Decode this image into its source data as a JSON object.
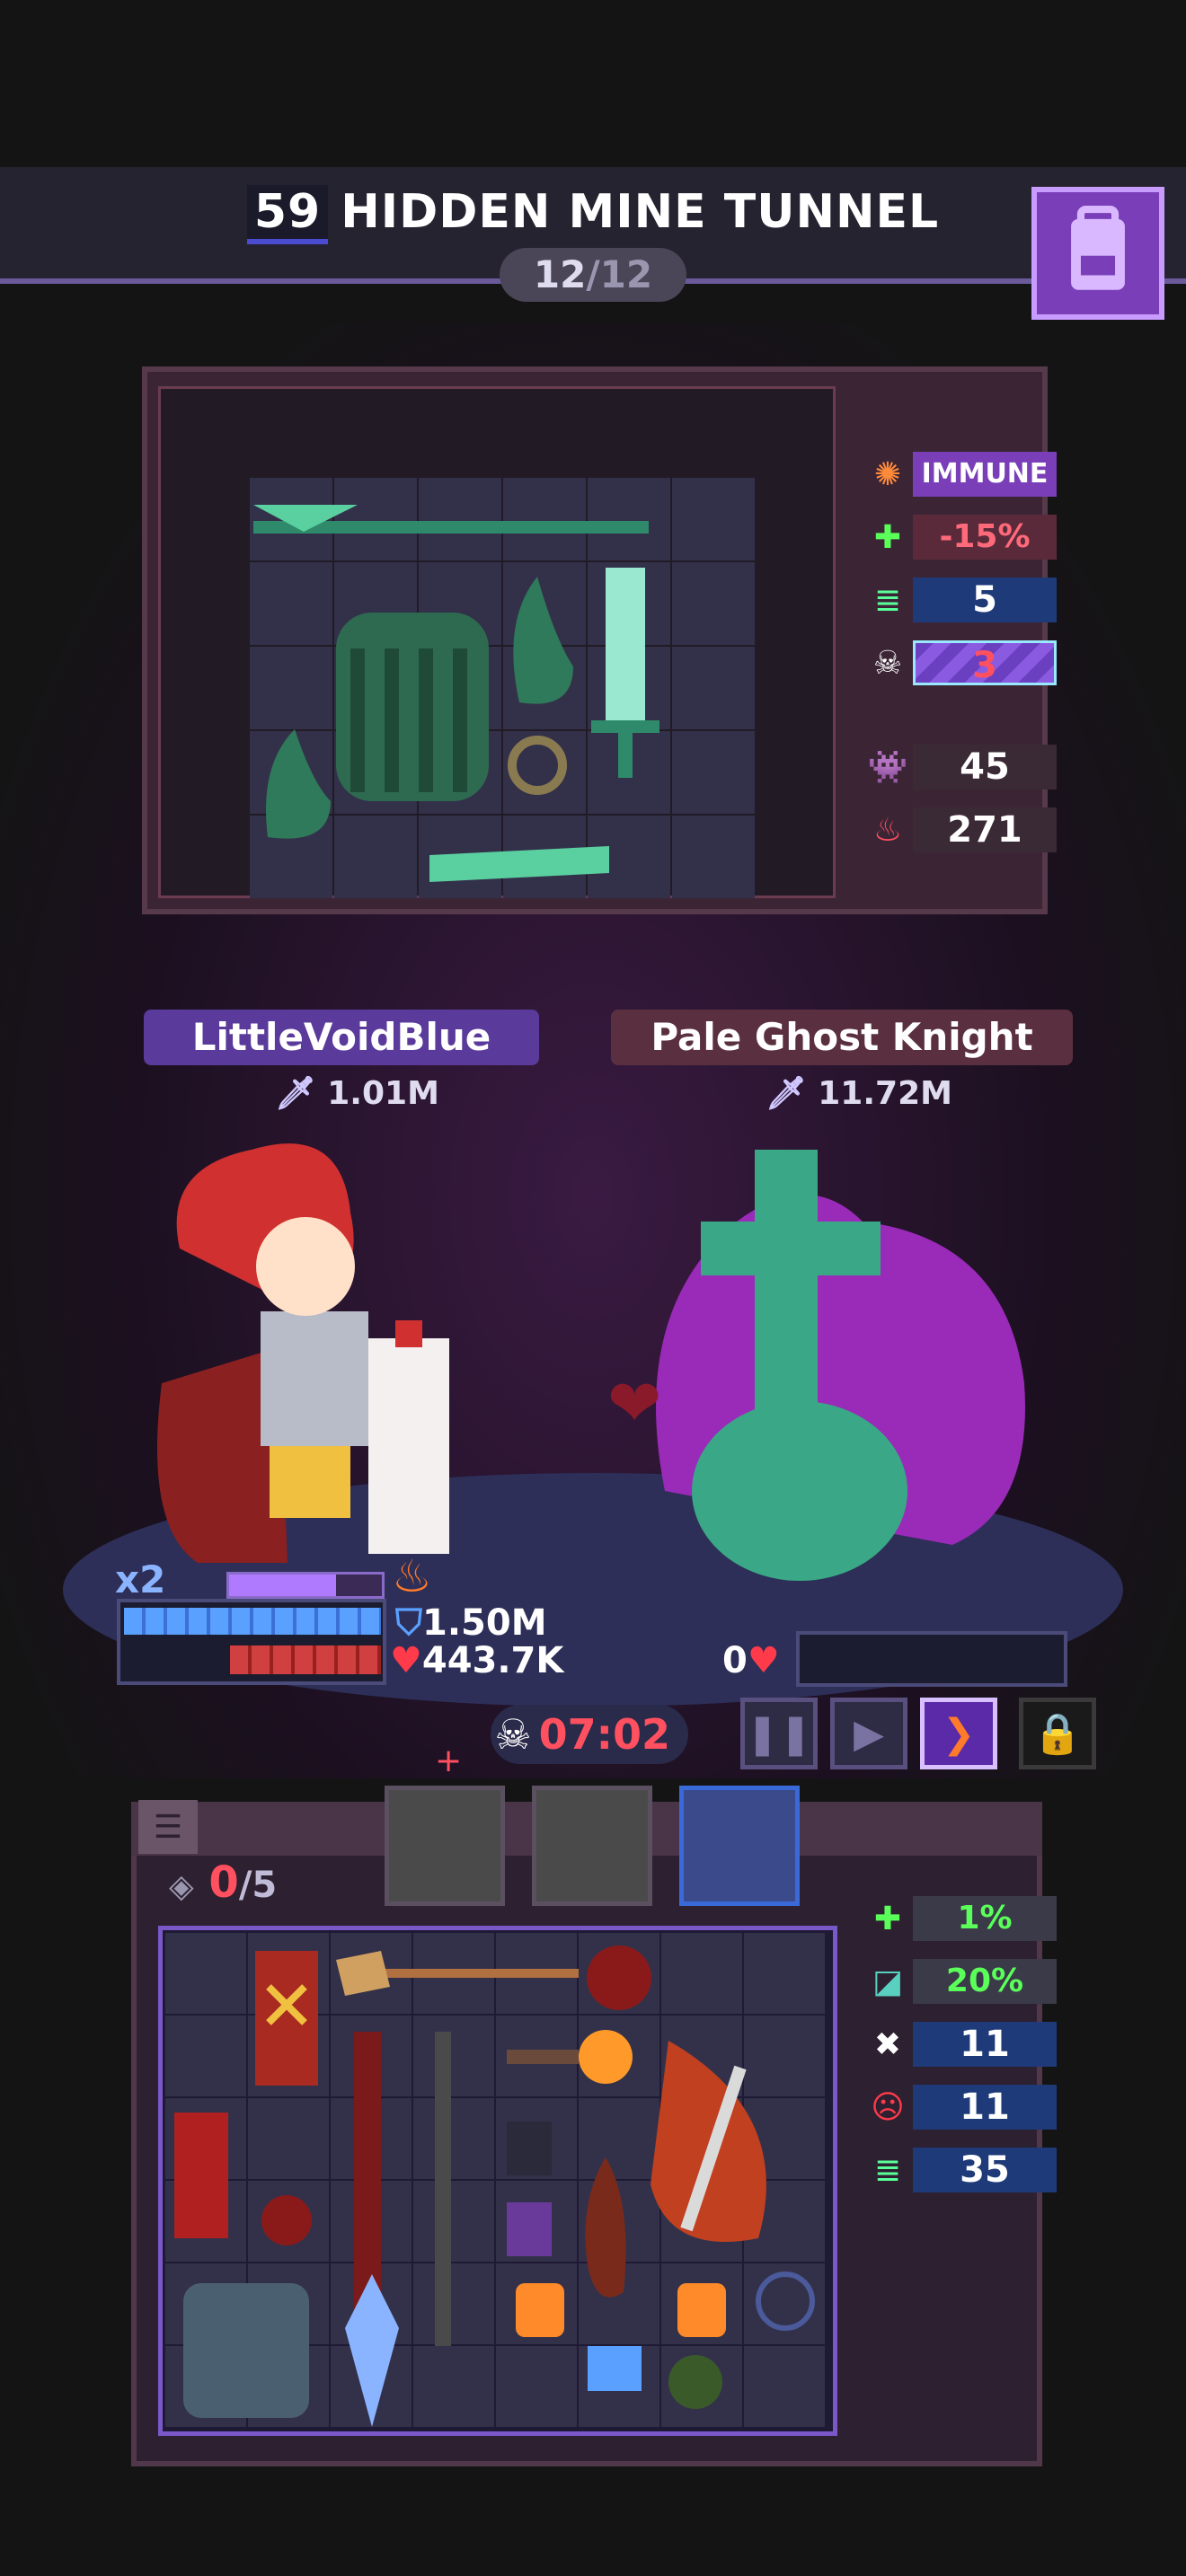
{
  "header": {
    "level": "59",
    "title": "HIDDEN MINE TUNNEL",
    "progress_current": "12",
    "progress_sep": "/",
    "progress_total": "12"
  },
  "enemy_stats": [
    {
      "icon": "immune-icon",
      "value": "IMMUNE",
      "color": "#7a3fb8"
    },
    {
      "icon": "heal-reduction-icon",
      "value": "-15%",
      "color": "#5a2a3a"
    },
    {
      "icon": "speed-icon",
      "value": "5",
      "color": "#1e3a78"
    },
    {
      "icon": "skull-icon",
      "value": "3",
      "color": "#6a3fc0"
    }
  ],
  "enemy_counts": [
    {
      "icon": "monster-icon",
      "value": "45"
    },
    {
      "icon": "sack-icon",
      "value": "271"
    }
  ],
  "player": {
    "name": "LittleVoidBlue",
    "attack": "1.01M",
    "multiplier": "x2",
    "shield": "1.50M",
    "hp": "443.7K"
  },
  "enemy": {
    "name": "Pale Ghost Knight",
    "attack": "11.72M",
    "hp": "0"
  },
  "battle": {
    "timer": "07:02"
  },
  "inventory": {
    "capacity_current": "0",
    "capacity_max": "/5"
  },
  "player_stats": [
    {
      "icon": "heal-icon",
      "value": "1%",
      "color": "#3a3a48",
      "text": "#5aff5a"
    },
    {
      "icon": "lifesteal-icon",
      "value": "20%",
      "color": "#3a3a48",
      "text": "#5aff5a"
    },
    {
      "icon": "crit-icon",
      "value": "11",
      "color": "#1e3a78",
      "text": "#ffffff"
    },
    {
      "icon": "rage-icon",
      "value": "11",
      "color": "#1e3a78",
      "text": "#ffffff"
    },
    {
      "icon": "speed-icon",
      "value": "35",
      "color": "#1e3a78",
      "text": "#ffffff"
    }
  ],
  "colors": {
    "accent_purple": "#7a3fb8",
    "hp_red": "#d04040",
    "shield_blue": "#5aa0ff",
    "timer_red": "#ff5060"
  }
}
